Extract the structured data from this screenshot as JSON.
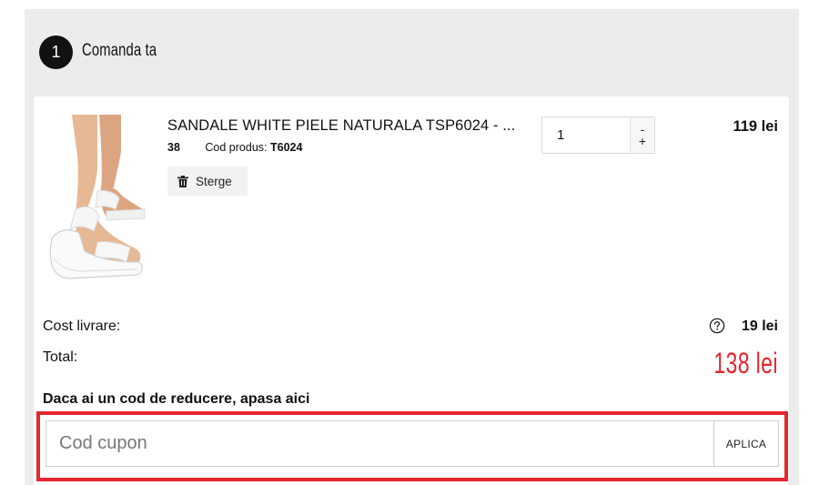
{
  "step": {
    "number": "1",
    "title": "Comanda ta"
  },
  "product": {
    "name": "SANDALE WHITE PIELE NATURALA TSP6024 - ...",
    "size": "38",
    "code_label": "Cod produs:",
    "code": "T6024",
    "delete_label": "Sterge",
    "delete_icon": "trash-icon",
    "quantity": "1",
    "qty_minus": "-",
    "qty_plus": "+",
    "price": "119 lei"
  },
  "summary": {
    "shipping_label": "Cost livrare:",
    "shipping_help_icon": "question-circle-icon",
    "shipping_value": "19 lei",
    "total_label": "Total:",
    "total_value": "138 lei"
  },
  "coupon": {
    "hint": "Daca ai un cod de reducere, apasa aici",
    "placeholder": "Cod cupon",
    "apply_label": "APLICA"
  },
  "colors": {
    "accent": "#e4262f",
    "panel_bg": "#ececec",
    "badge_bg": "#111111"
  }
}
